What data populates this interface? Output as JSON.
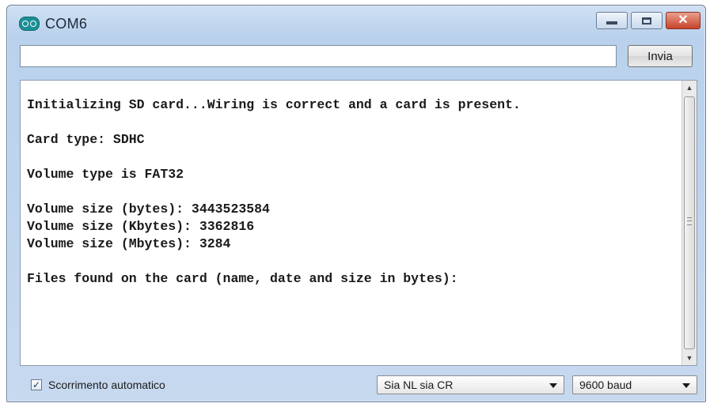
{
  "window": {
    "title": "COM6",
    "icon": "arduino-icon"
  },
  "controls": {
    "minimize": "minimize-icon",
    "maximize": "maximize-icon",
    "close": "close-icon"
  },
  "input": {
    "value": "",
    "placeholder": ""
  },
  "send_button": {
    "label": "Invia"
  },
  "output": {
    "lines": [
      "Initializing SD card...Wiring is correct and a card is present.",
      "",
      "Card type: SDHC",
      "",
      "Volume type is FAT32",
      "",
      "Volume size (bytes): 3443523584",
      "Volume size (Kbytes): 3362816",
      "Volume size (Mbytes): 3284",
      "",
      "Files found on the card (name, date and size in bytes):"
    ]
  },
  "status_bar": {
    "autoscroll_label": "Scorrimento automatico",
    "autoscroll_checked": true,
    "line_ending": "Sia NL sia CR",
    "baud_rate": "9600 baud"
  }
}
